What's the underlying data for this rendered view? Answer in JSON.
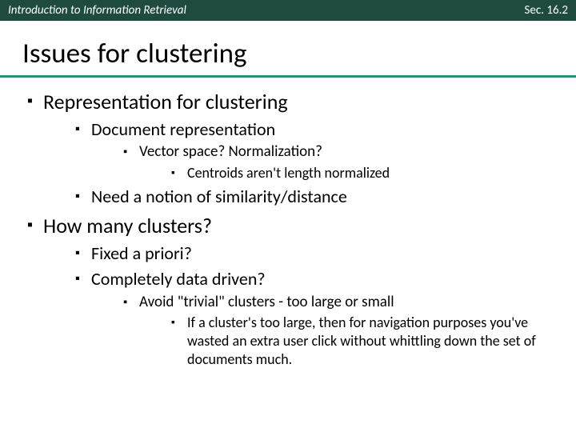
{
  "header": {
    "left": "Introduction to Information Retrieval",
    "right": "Sec. 16.2"
  },
  "title": "Issues for clustering",
  "bullets": {
    "a": "Representation for clustering",
    "a1": "Document representation",
    "a1a": "Vector space?  Normalization?",
    "a1a1": "Centroids aren't length normalized",
    "a2": "Need a notion of similarity/distance",
    "b": "How many clusters?",
    "b1": "Fixed a priori?",
    "b2": "Completely data driven?",
    "b2a": "Avoid \"trivial\" clusters - too large or small",
    "b2a1": "If a cluster's too large, then for navigation purposes you've wasted an extra user click without whittling down the set of documents much."
  }
}
